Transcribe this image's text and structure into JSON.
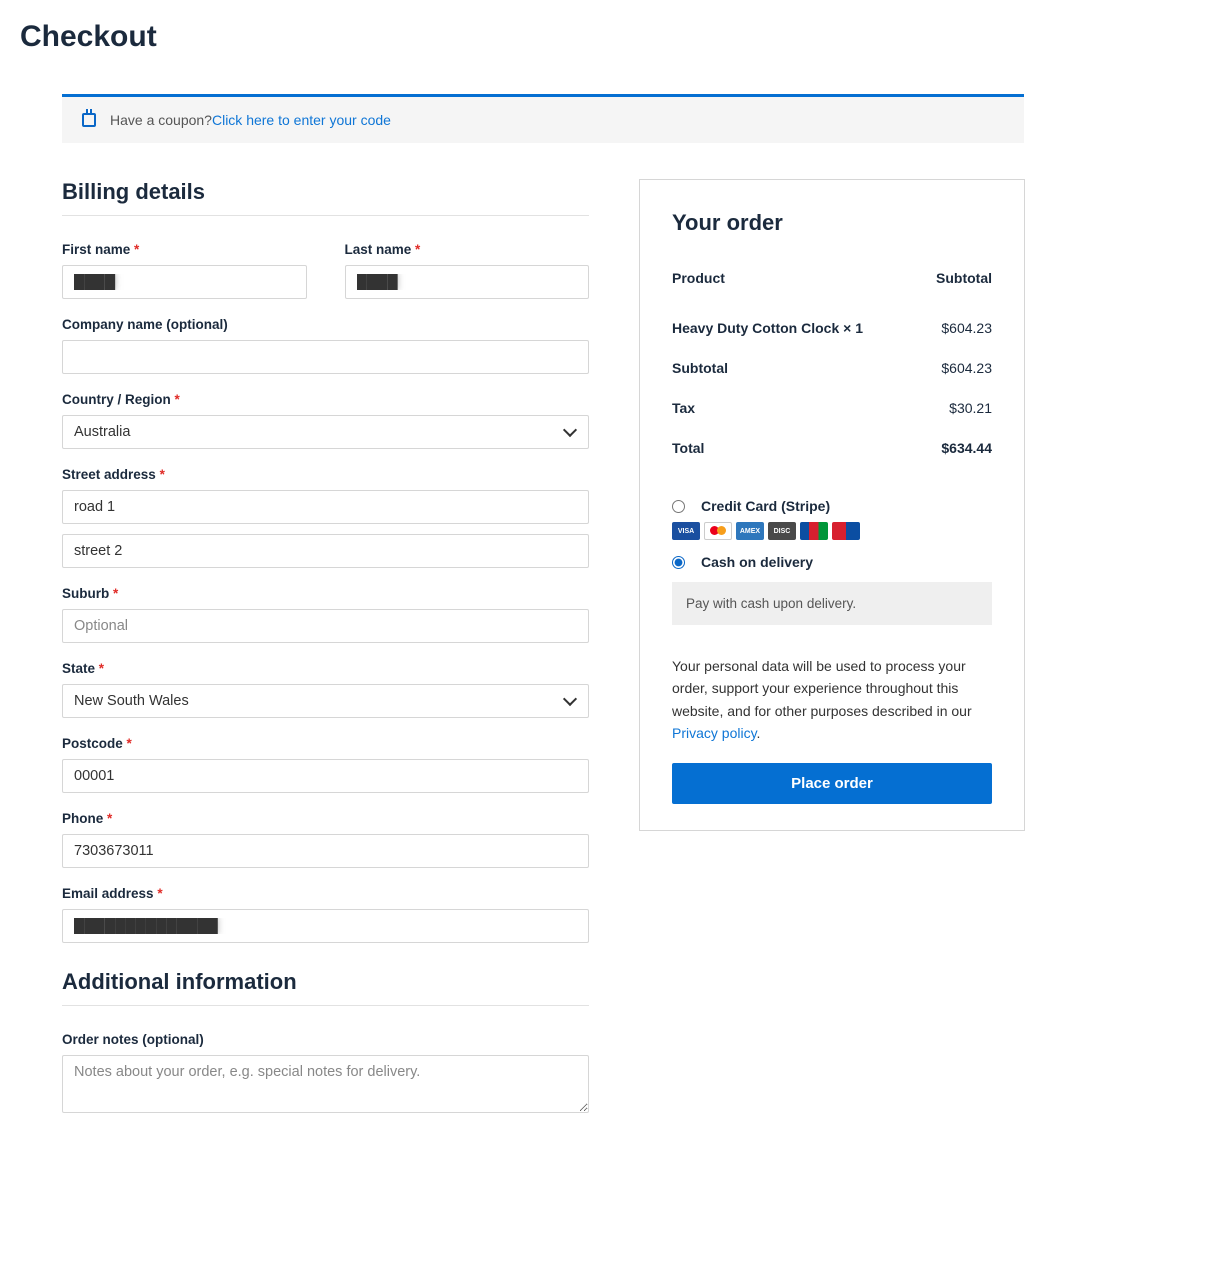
{
  "page_title": "Checkout",
  "coupon": {
    "prompt": "Have a coupon? ",
    "link": "Click here to enter your code"
  },
  "billing": {
    "heading": "Billing details",
    "first_name": {
      "label": "First name",
      "value": ""
    },
    "last_name": {
      "label": "Last name",
      "value": ""
    },
    "company": {
      "label": "Company name (optional)",
      "value": ""
    },
    "country": {
      "label": "Country / Region",
      "value": "Australia"
    },
    "street": {
      "label": "Street address",
      "value1": "road 1",
      "value2": "street 2"
    },
    "suburb": {
      "label": "Suburb",
      "placeholder": "Optional",
      "value": ""
    },
    "state": {
      "label": "State",
      "value": "New South Wales"
    },
    "postcode": {
      "label": "Postcode",
      "value": "00001"
    },
    "phone": {
      "label": "Phone",
      "value": "7303673011"
    },
    "email": {
      "label": "Email address",
      "value": ""
    }
  },
  "additional": {
    "heading": "Additional information",
    "notes_label": "Order notes (optional)",
    "notes_placeholder": "Notes about your order, e.g. special notes for delivery."
  },
  "order": {
    "heading": "Your order",
    "col_product": "Product",
    "col_subtotal": "Subtotal",
    "item_name": "Heavy Duty Cotton Clock  × 1",
    "item_price": "$604.23",
    "subtotal_label": "Subtotal",
    "subtotal_value": "$604.23",
    "tax_label": "Tax",
    "tax_value": "$30.21",
    "total_label": "Total",
    "total_value": "$634.44"
  },
  "payment": {
    "stripe_label": "Credit Card (Stripe)",
    "cod_label": "Cash on delivery",
    "cod_desc": "Pay with cash upon delivery."
  },
  "privacy": {
    "text": "Your personal data will be used to process your order, support your experience throughout this website, and for other purposes described in our ",
    "link": "Privacy policy",
    "dot": "."
  },
  "place_order": "Place order",
  "required_mark": "*",
  "hidden_first": "████",
  "hidden_last": "████",
  "hidden_email": "██████████████"
}
